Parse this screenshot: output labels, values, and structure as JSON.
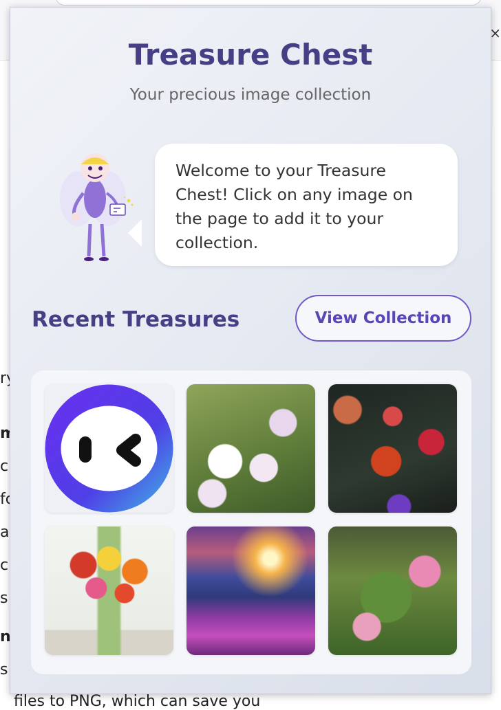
{
  "background_page": {
    "close_glyph": "×",
    "text_fragments": [
      "ry",
      "m",
      "c",
      "fc",
      "a",
      "ck",
      "s",
      "nv",
      "s"
    ],
    "bottom_line": "files to PNG, which can save you"
  },
  "popup": {
    "title": "Treasure Chest",
    "subtitle": "Your precious image collection",
    "welcome_message": "Welcome to your Treasure Chest! Click on any image on the page to add it to your collection.",
    "recent_title": "Recent Treasures",
    "view_collection_label": "View Collection",
    "thumbnails": [
      {
        "name": "app-logo-image"
      },
      {
        "name": "pink-anemone-flowers"
      },
      {
        "name": "red-roses-bouquet"
      },
      {
        "name": "gerbera-daisy-vase"
      },
      {
        "name": "mountain-sunset-meadow"
      },
      {
        "name": "pink-lotus-flowers"
      }
    ]
  },
  "colors": {
    "accent": "#473f85",
    "button": "#7058c8"
  }
}
